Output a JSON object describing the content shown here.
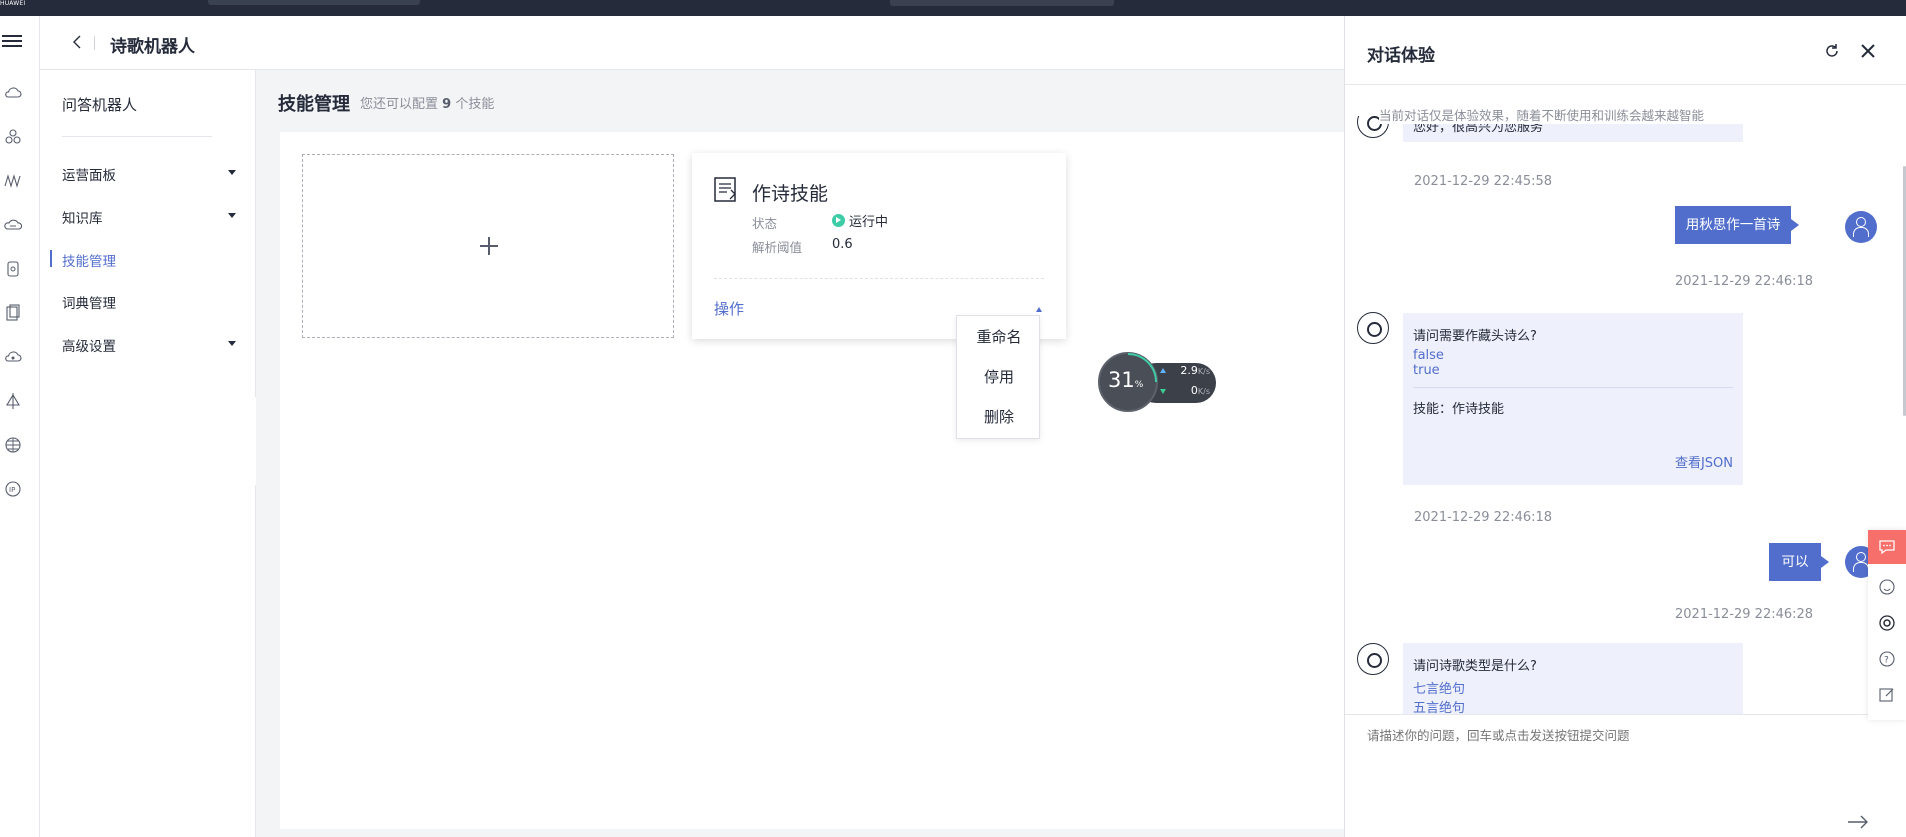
{
  "topbar": {
    "brand": "HUAWEI"
  },
  "header": {
    "title": "诗歌机器人"
  },
  "sidebar": {
    "title": "问答机器人",
    "items": [
      {
        "label": "运营面板",
        "expandable": true
      },
      {
        "label": "知识库",
        "expandable": true
      },
      {
        "label": "技能管理",
        "active": true
      },
      {
        "label": "词典管理"
      },
      {
        "label": "高级设置",
        "expandable": true
      }
    ]
  },
  "main": {
    "title": "技能管理",
    "subtitle_prefix": "您还可以配置",
    "subtitle_count": "9",
    "subtitle_suffix": "个技能",
    "skill_card": {
      "name": "作诗技能",
      "status_label": "状态",
      "status_value": "运行中",
      "threshold_label": "解析阈值",
      "threshold_value": "0.6",
      "action_label": "操作"
    },
    "dropdown": [
      "重命名",
      "停用",
      "删除"
    ]
  },
  "net_widget": {
    "percent": "31",
    "percent_unit": "%",
    "upload": "2.9",
    "upload_unit": "K/s",
    "download": "0",
    "download_unit": "K/s"
  },
  "chat": {
    "title": "对话体验",
    "notice": "当前对话仅是体验效果，随着不断使用和训练会越来越智能",
    "input_placeholder": "请描述你的问题，回车或点击发送按钮提交问题",
    "messages": {
      "m1_text": "您好，很高兴为您服务",
      "m1_time": "2021-12-29 22:45:58",
      "m2_text": "用秋思作一首诗",
      "m2_time": "2021-12-29 22:46:18",
      "m3_question": "请问需要作藏头诗么?",
      "m3_opt1": "false",
      "m3_opt2": "true",
      "m3_skill": "技能：作诗技能",
      "m3_link": "查看JSON",
      "m3_time": "2021-12-29 22:46:18",
      "m4_text": "可以",
      "m4_time": "2021-12-29 22:46:28",
      "m5_question": "请问诗歌类型是什么?",
      "m5_opt1": "七言绝句",
      "m5_opt2": "五言绝句"
    }
  },
  "colors": {
    "accent": "#526ecc",
    "topbar": "#252b3a",
    "running": "#3dcca6",
    "side_red": "#f66f6a"
  }
}
